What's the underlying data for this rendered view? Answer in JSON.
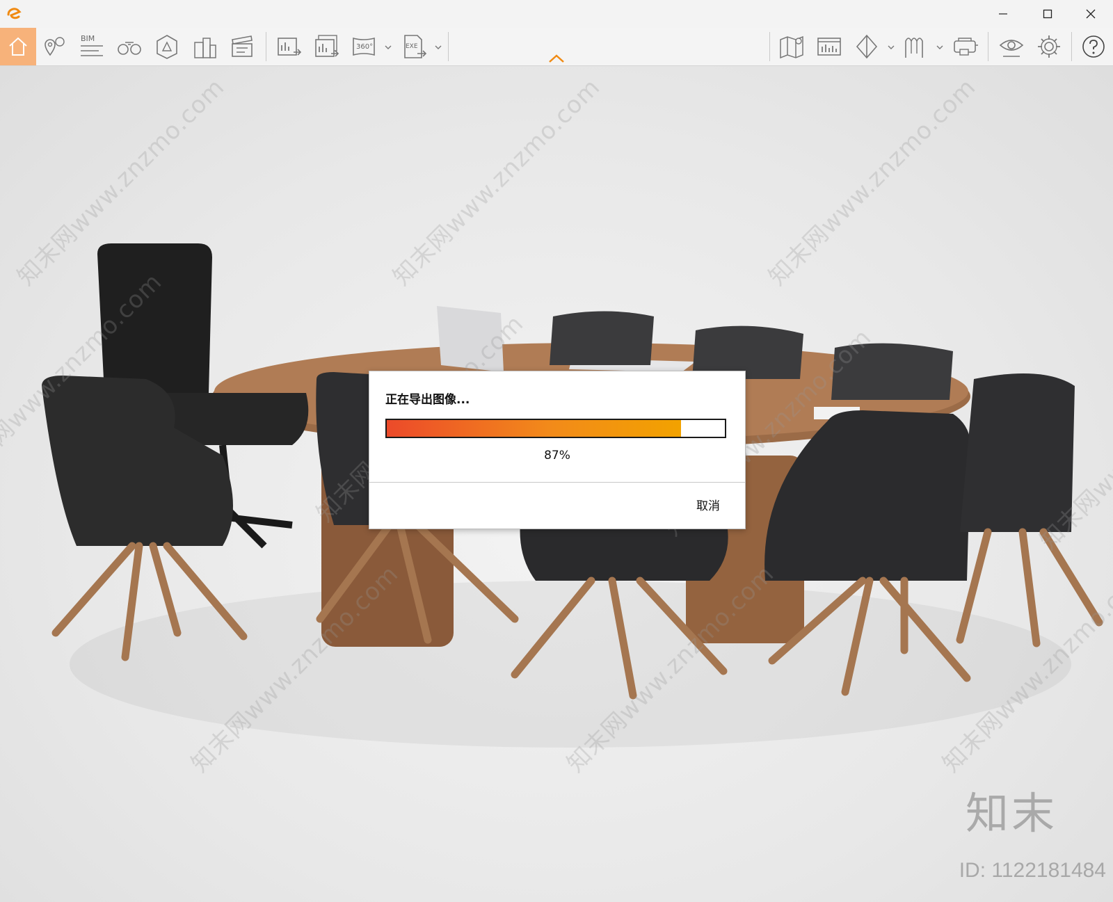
{
  "window": {
    "icons": {
      "app": "app-logo-icon",
      "minimize": "minimize-icon",
      "maximize": "maximize-icon",
      "close": "close-icon"
    }
  },
  "toolbar": {
    "accent_color": "#f7b27a",
    "left_tools": [
      "home-icon",
      "location-pin-icon",
      "bim-icon",
      "binoculars-icon",
      "scene-asset-icon",
      "buildings-icon",
      "clapperboard-icon"
    ],
    "bim_label": "BIM",
    "export_tools": [
      "export-image-icon",
      "batch-export-icon",
      "export-360-icon",
      "export-exe-icon"
    ],
    "export_360_label": "360°",
    "export_exe_label": "EXE",
    "right_tools": [
      "map-icon",
      "panel-icon",
      "section-cube-icon",
      "paths-icon",
      "vr-headset-icon",
      "eye-icon",
      "gear-icon",
      "help-icon"
    ]
  },
  "dialog": {
    "title": "正在导出图像...",
    "progress_fraction": 0.87,
    "progress_text": "87%",
    "cancel_label": "取消"
  },
  "watermarks": {
    "repeat_text": "知末网www.znzmo.com",
    "brand": "知末",
    "id_text": "ID: 1122181484"
  }
}
